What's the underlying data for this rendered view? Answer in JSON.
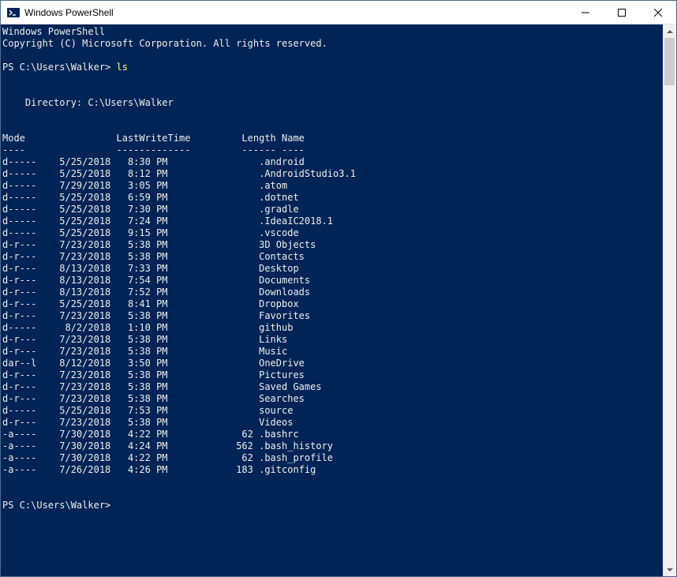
{
  "titlebar": {
    "title": "Windows PowerShell"
  },
  "header": {
    "line1": "Windows PowerShell",
    "line2": "Copyright (C) Microsoft Corporation. All rights reserved."
  },
  "prompt1": {
    "prefix": "PS C:\\Users\\Walker> ",
    "command": "ls"
  },
  "directory_line": "    Directory: C:\\Users\\Walker",
  "columns": {
    "mode": "Mode",
    "lwt": "LastWriteTime",
    "length": "Length",
    "name": "Name"
  },
  "underline": {
    "mode": "----",
    "lwt": "-------------",
    "length": "------",
    "name": "----"
  },
  "rows": [
    {
      "mode": "d-----",
      "date": "5/25/2018",
      "time": "8:30 PM",
      "length": "",
      "name": ".android"
    },
    {
      "mode": "d-----",
      "date": "5/25/2018",
      "time": "8:12 PM",
      "length": "",
      "name": ".AndroidStudio3.1"
    },
    {
      "mode": "d-----",
      "date": "7/29/2018",
      "time": "3:05 PM",
      "length": "",
      "name": ".atom"
    },
    {
      "mode": "d-----",
      "date": "5/25/2018",
      "time": "6:59 PM",
      "length": "",
      "name": ".dotnet"
    },
    {
      "mode": "d-----",
      "date": "5/25/2018",
      "time": "7:30 PM",
      "length": "",
      "name": ".gradle"
    },
    {
      "mode": "d-----",
      "date": "5/25/2018",
      "time": "7:24 PM",
      "length": "",
      "name": ".IdeaIC2018.1"
    },
    {
      "mode": "d-----",
      "date": "5/25/2018",
      "time": "9:15 PM",
      "length": "",
      "name": ".vscode"
    },
    {
      "mode": "d-r---",
      "date": "7/23/2018",
      "time": "5:38 PM",
      "length": "",
      "name": "3D Objects"
    },
    {
      "mode": "d-r---",
      "date": "7/23/2018",
      "time": "5:38 PM",
      "length": "",
      "name": "Contacts"
    },
    {
      "mode": "d-r---",
      "date": "8/13/2018",
      "time": "7:33 PM",
      "length": "",
      "name": "Desktop"
    },
    {
      "mode": "d-r---",
      "date": "8/13/2018",
      "time": "7:54 PM",
      "length": "",
      "name": "Documents"
    },
    {
      "mode": "d-r---",
      "date": "8/13/2018",
      "time": "7:52 PM",
      "length": "",
      "name": "Downloads"
    },
    {
      "mode": "d-r---",
      "date": "5/25/2018",
      "time": "8:41 PM",
      "length": "",
      "name": "Dropbox"
    },
    {
      "mode": "d-r---",
      "date": "7/23/2018",
      "time": "5:38 PM",
      "length": "",
      "name": "Favorites"
    },
    {
      "mode": "d-----",
      "date": "8/2/2018",
      "time": "1:10 PM",
      "length": "",
      "name": "github"
    },
    {
      "mode": "d-r---",
      "date": "7/23/2018",
      "time": "5:38 PM",
      "length": "",
      "name": "Links"
    },
    {
      "mode": "d-r---",
      "date": "7/23/2018",
      "time": "5:38 PM",
      "length": "",
      "name": "Music"
    },
    {
      "mode": "dar--l",
      "date": "8/12/2018",
      "time": "3:50 PM",
      "length": "",
      "name": "OneDrive"
    },
    {
      "mode": "d-r---",
      "date": "7/23/2018",
      "time": "5:38 PM",
      "length": "",
      "name": "Pictures"
    },
    {
      "mode": "d-r---",
      "date": "7/23/2018",
      "time": "5:38 PM",
      "length": "",
      "name": "Saved Games"
    },
    {
      "mode": "d-r---",
      "date": "7/23/2018",
      "time": "5:38 PM",
      "length": "",
      "name": "Searches"
    },
    {
      "mode": "d-----",
      "date": "5/25/2018",
      "time": "7:53 PM",
      "length": "",
      "name": "source"
    },
    {
      "mode": "d-r---",
      "date": "7/23/2018",
      "time": "5:38 PM",
      "length": "",
      "name": "Videos"
    },
    {
      "mode": "-a----",
      "date": "7/30/2018",
      "time": "4:22 PM",
      "length": "62",
      "name": ".bashrc"
    },
    {
      "mode": "-a----",
      "date": "7/30/2018",
      "time": "4:24 PM",
      "length": "562",
      "name": ".bash_history"
    },
    {
      "mode": "-a----",
      "date": "7/30/2018",
      "time": "4:22 PM",
      "length": "62",
      "name": ".bash_profile"
    },
    {
      "mode": "-a----",
      "date": "7/26/2018",
      "time": "4:26 PM",
      "length": "183",
      "name": ".gitconfig"
    }
  ],
  "prompt2": {
    "prefix": "PS C:\\Users\\Walker> "
  }
}
